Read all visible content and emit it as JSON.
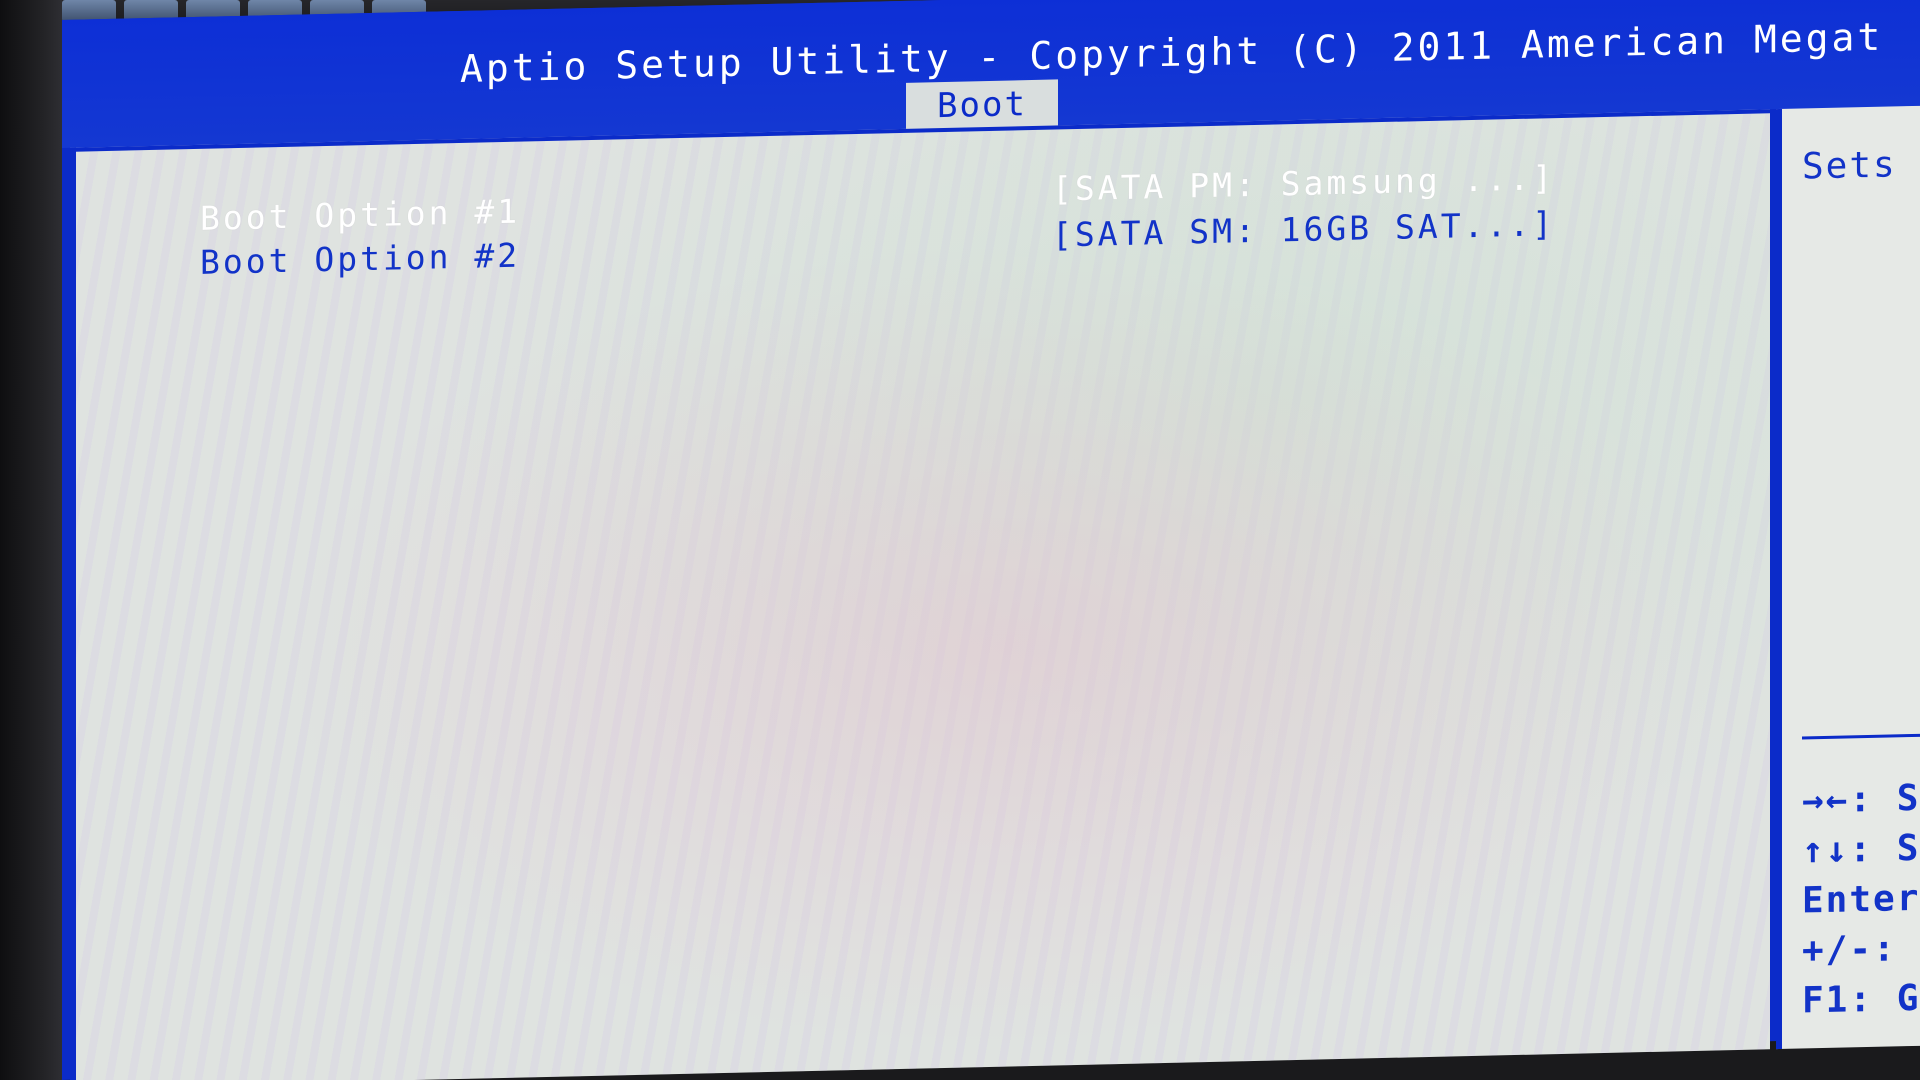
{
  "header": {
    "title": "Aptio Setup Utility - Copyright (C) 2011 American Megat",
    "active_tab": "Boot"
  },
  "boot_options": [
    {
      "label": "Boot Option #1",
      "value": "[SATA  PM: Samsung ...]",
      "selected": true
    },
    {
      "label": "Boot Option #2",
      "value": "[SATA  SM: 16GB SAT...]",
      "selected": false
    }
  ],
  "help_panel": {
    "text": "Sets",
    "keys": [
      "→←: S",
      "↑↓: S",
      "Enter",
      "+/-:",
      "F1: G"
    ]
  },
  "colors": {
    "bios_blue": "#0b2bc9",
    "panel_gray": "#dfe3e0",
    "selected_text": "#ffffff"
  }
}
